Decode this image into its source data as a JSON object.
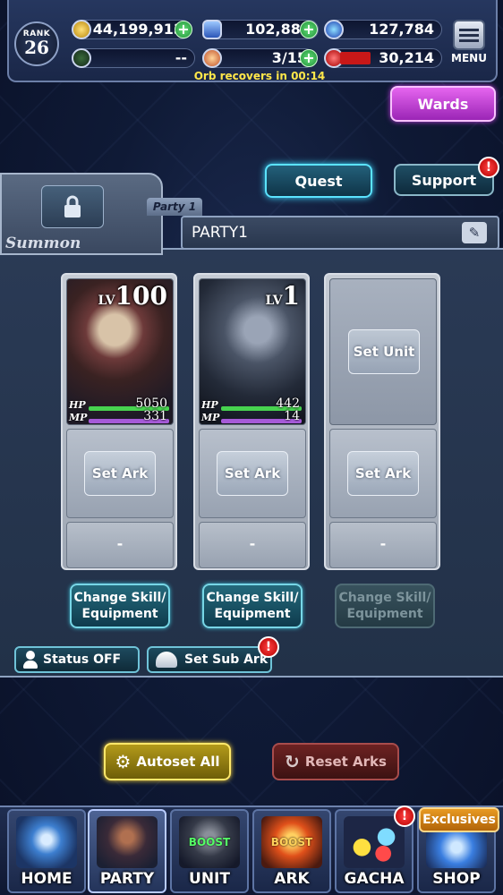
{
  "header": {
    "rank_label": "RANK",
    "rank_value": "26",
    "gold": "44,199,913",
    "crystals": "102,880",
    "blue_currency": "127,784",
    "guild_value": "--",
    "orbs": "3/15",
    "red_currency": "30,214",
    "orb_recover_text": "Orb recovers in 00:14",
    "menu_label": "MENU",
    "plus_symbol": "+"
  },
  "buttons": {
    "wards": "Wards",
    "quest": "Quest",
    "support": "Support",
    "alert_symbol": "!"
  },
  "party": {
    "summon_label": "Summon",
    "tab_label": "Party 1",
    "name": "PARTY1",
    "units": [
      {
        "lv_prefix": "LV",
        "level": "100",
        "hp_label": "HP",
        "hp": "5050",
        "mp_label": "MP",
        "mp": "331",
        "ark": "Set Ark",
        "sub": "-",
        "change_line1": "Change Skill/",
        "change_line2": "Equipment"
      },
      {
        "lv_prefix": "LV",
        "level": "1",
        "hp_label": "HP",
        "hp": "442",
        "mp_label": "MP",
        "mp": "14",
        "ark": "Set Ark",
        "sub": "-",
        "change_line1": "Change Skill/",
        "change_line2": "Equipment"
      },
      {
        "set_unit": "Set Unit",
        "ark": "Set Ark",
        "sub": "-",
        "change_line1": "Change Skill/",
        "change_line2": "Equipment"
      }
    ],
    "status_btn": "Status OFF",
    "sub_ark_btn": "Set Sub Ark",
    "autoset": "Autoset All",
    "reset": "Reset Arks"
  },
  "nav": {
    "items": [
      {
        "label": "HOME"
      },
      {
        "label": "PARTY"
      },
      {
        "label": "UNIT",
        "badge": "BOOST"
      },
      {
        "label": "ARK",
        "badge": "BOOST"
      },
      {
        "label": "GACHA"
      },
      {
        "label": "SHOP"
      }
    ],
    "exclusives": "Exclusives"
  },
  "colors": {
    "accent_cyan": "#5be3ff",
    "wards_purple": "#c03ee0",
    "alert_red": "#d00000",
    "autoset_gold": "#ffd83a"
  }
}
